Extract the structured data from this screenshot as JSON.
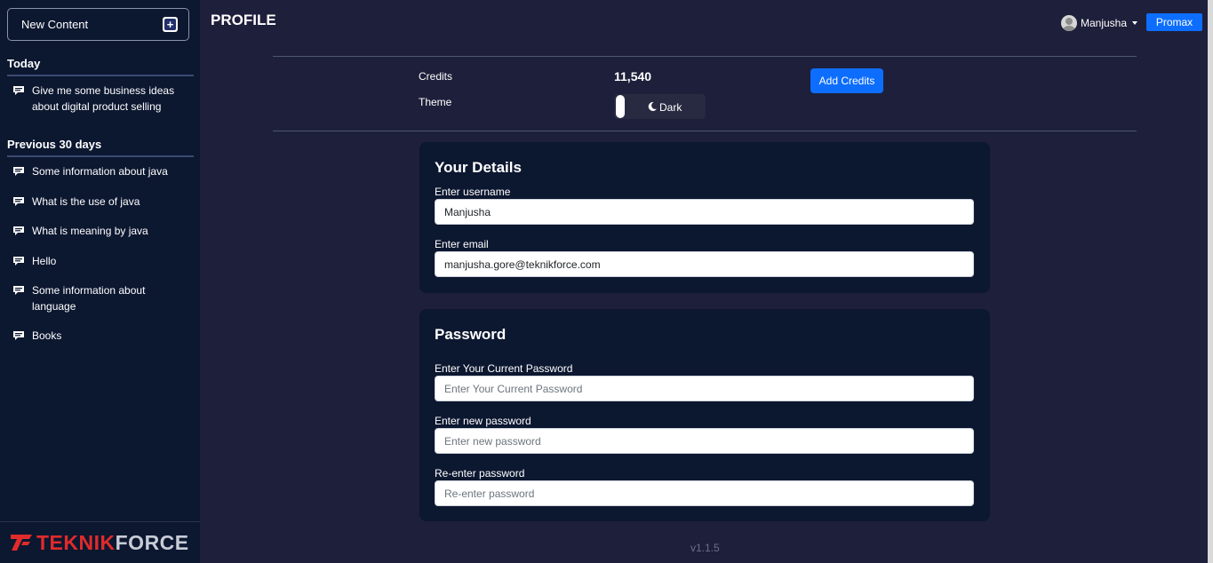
{
  "sidebar": {
    "new_content_label": "New Content",
    "sections": [
      {
        "title": "Today",
        "items": [
          {
            "label": "Give me some business ideas about digital product selling"
          }
        ]
      },
      {
        "title": "Previous 30 days",
        "items": [
          {
            "label": "Some information about java"
          },
          {
            "label": "What is the use of java"
          },
          {
            "label": "What is meaning by java"
          },
          {
            "label": "Hello"
          },
          {
            "label": "Some information about language"
          },
          {
            "label": "Books"
          }
        ]
      }
    ],
    "brand": {
      "part1": "TEKNIK",
      "part2": "FORCE"
    }
  },
  "header": {
    "title": "PROFILE",
    "user_name": "Manjusha",
    "plan_badge": "Promax"
  },
  "account": {
    "credits_label": "Credits",
    "credits_value": "11,540",
    "add_credits_label": "Add Credits",
    "theme_label": "Theme",
    "theme_value": "Dark"
  },
  "details_card": {
    "title": "Your Details",
    "username_label": "Enter username",
    "username_value": "Manjusha",
    "email_label": "Enter email",
    "email_value": "manjusha.gore@teknikforce.com"
  },
  "password_card": {
    "title": "Password",
    "current_label": "Enter Your Current Password",
    "current_placeholder": "Enter Your Current Password",
    "new_label": "Enter new password",
    "new_placeholder": "Enter new password",
    "reenter_label": "Re-enter password",
    "reenter_placeholder": "Re-enter password"
  },
  "footer": {
    "version": "v1.1.5"
  },
  "colors": {
    "sidebar_bg": "#0c1730",
    "page_bg": "#1e1f3b",
    "accent": "#0d6efd",
    "brand_red": "#e02b2b"
  },
  "icons": {
    "new_content": "plus-icon",
    "chat_item": "chat-bubble-icon",
    "theme": "moon-icon",
    "user_menu": "chevron-down-icon"
  }
}
